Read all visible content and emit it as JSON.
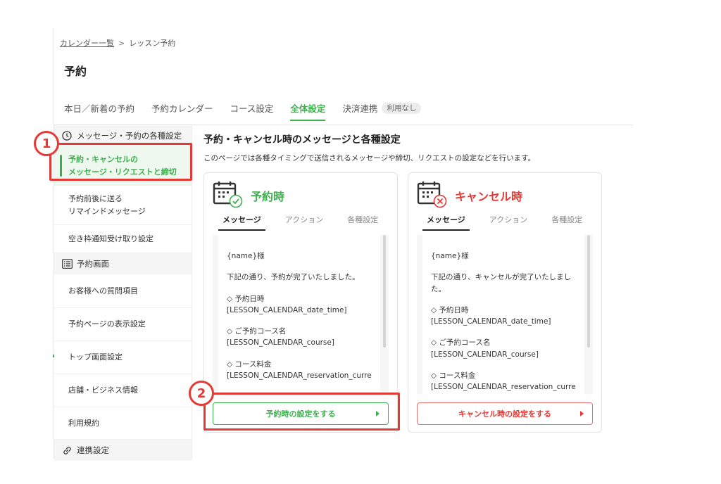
{
  "breadcrumb": {
    "link": "カレンダー一覧",
    "separator": ">",
    "current": "レッスン予約"
  },
  "page_title": "予約",
  "tabs": [
    {
      "label": "本日／新着の予約"
    },
    {
      "label": "予約カレンダー"
    },
    {
      "label": "コース設定"
    },
    {
      "label": "全体設定",
      "active": true
    },
    {
      "label": "決済連携",
      "badge": "利用なし"
    }
  ],
  "sidebar": {
    "section1": {
      "title": "メッセージ・予約の各種設定",
      "icon": "clock-icon"
    },
    "item_active": {
      "line1": "予約・キャンセルの",
      "line2": "メッセージ・リクエストと締切"
    },
    "item_remind": {
      "line1": "予約前後に送る",
      "line2": "リマインドメッセージ"
    },
    "item_vacancy": "空き枠通知受け取り設定",
    "section2": {
      "title": "予約画面",
      "icon": "list-icon"
    },
    "item_questions": "お客様への質問項目",
    "item_display": "予約ページの表示設定",
    "item_top": "トップ画面設定",
    "item_store": "店舗・ビジネス情報",
    "item_terms": "利用規約",
    "section3": {
      "title": "連携設定",
      "icon": "link-icon"
    }
  },
  "main": {
    "title": "予約・キャンセル時のメッセージと各種設定",
    "description": "このページでは各種タイミングで送信されるメッセージや締切、リクエストの設定などを行います。"
  },
  "cards": {
    "reserve": {
      "title": "予約時",
      "tabs": [
        "メッセージ",
        "アクション",
        "各種設定"
      ],
      "lines": [
        "{name}様",
        "下記の通り、予約が完了いたしました。",
        "◇ 予約日時",
        "[LESSON_CALENDAR_date_time]",
        "◇ ご予約コース名",
        "[LESSON_CALENDAR_course]",
        "◇ コース料金",
        "[LESSON_CALENDAR_reservation_curre"
      ],
      "button": "予約時の設定をする"
    },
    "cancel": {
      "title": "キャンセル時",
      "tabs": [
        "メッセージ",
        "アクション",
        "各種設定"
      ],
      "lines": [
        "{name}様",
        "下記の通り、キャンセルが完了いたしました。",
        "◇ 予約日時",
        "[LESSON_CALENDAR_date_time]",
        "◇ ご予約コース名",
        "[LESSON_CALENDAR_course]",
        "◇ コース料金",
        "[LESSON_CALENDAR_reservation_curre"
      ],
      "button": "キャンセル時の設定をする"
    }
  },
  "annotations": {
    "one": "1",
    "two": "2"
  },
  "colors": {
    "accent_green": "#3db14d",
    "accent_red": "#e53935",
    "highlight_red": "#e53935"
  }
}
